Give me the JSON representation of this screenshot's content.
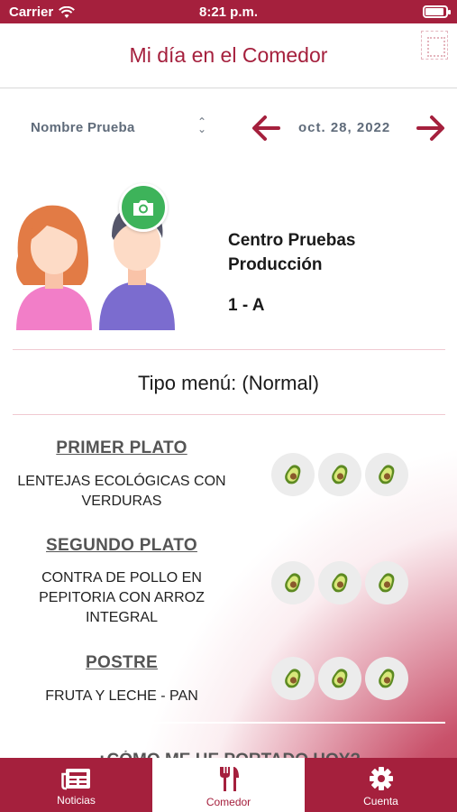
{
  "status_bar": {
    "carrier": "Carrier",
    "time": "8:21 p.m."
  },
  "header": {
    "title": "Mi día en el Comedor"
  },
  "selector": {
    "name": "Nombre Prueba",
    "date": "oct. 28, 2022"
  },
  "profile": {
    "school_line1": "Centro Pruebas",
    "school_line2": "Producción",
    "class": "1 - A"
  },
  "menu": {
    "type_label": "Tipo menú: (Normal)",
    "courses": [
      {
        "title": "PRIMER PLATO",
        "lines": [
          "LENTEJAS ECOLÓGICAS CON",
          "VERDURAS"
        ],
        "rating_icon_count": 3
      },
      {
        "title": "SEGUNDO PLATO",
        "lines": [
          "CONTRA DE POLLO EN",
          "PEPITORIA CON ARROZ",
          "INTEGRAL"
        ],
        "rating_icon_count": 3
      },
      {
        "title": "POSTRE",
        "lines": [
          "FRUTA Y LECHE - PAN"
        ],
        "rating_icon_count": 3
      }
    ],
    "rating_icon": "avocado-icon"
  },
  "next_section_partial": "¿CÓMO ME HE PORTADO HOY?",
  "tabs": [
    {
      "label": "Noticias",
      "icon": "newspaper-icon",
      "active": false
    },
    {
      "label": "Comedor",
      "icon": "fork-knife-icon",
      "active": true
    },
    {
      "label": "Cuenta",
      "icon": "gear-icon",
      "active": false
    }
  ],
  "colors": {
    "brand": "#a5203d",
    "accent_green": "#3db35a",
    "muted_text": "#5f6b7a"
  }
}
